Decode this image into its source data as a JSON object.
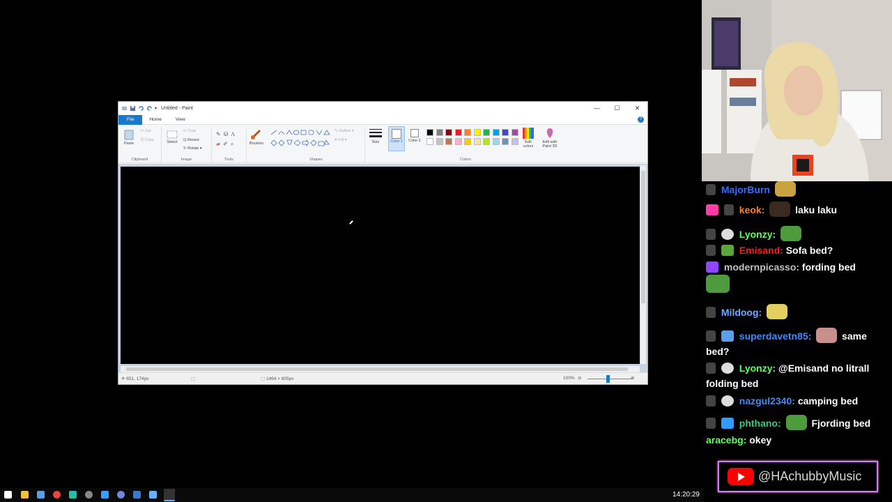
{
  "paint": {
    "title": "Untitled - Paint",
    "tabs": [
      "File",
      "Home",
      "View"
    ],
    "ribbon": {
      "paste": "Paste",
      "cut": "Cut",
      "copy": "Copy",
      "select": "Select",
      "crop": "Crop",
      "resize": "Resize",
      "rotate": "Rotate",
      "brushes": "Brushes",
      "outline": "Outline",
      "fill": "Fill",
      "size": "Size",
      "color1": "Color 1",
      "color2": "Color 2",
      "edit_colors": "Edit colors",
      "edit_paint3d": "Edit with Paint 3D",
      "groups": {
        "clipboard": "Clipboard",
        "image": "Image",
        "tools": "Tools",
        "shapes": "Shapes",
        "colors": "Colors"
      }
    },
    "palette": [
      "#000000",
      "#7f7f7f",
      "#880015",
      "#ed1c24",
      "#ff7f27",
      "#fff200",
      "#22b14c",
      "#00a2e8",
      "#3f48cc",
      "#a349a4",
      "#ffffff",
      "#c3c3c3",
      "#b97a57",
      "#ffaec9",
      "#ffc90e",
      "#efe4b0",
      "#b5e61d",
      "#99d9ea",
      "#7092be",
      "#c8bfe7"
    ],
    "status": {
      "cursor_pos": "651, 174px",
      "canvas_size": "1494 × 805px",
      "zoom": "100%"
    }
  },
  "chat": [
    {
      "user": "MajorBurn",
      "color": "#3b6bff",
      "text": ""
    },
    {
      "user": "keok:",
      "color": "#ff7f2a",
      "text": "laku laku"
    },
    {
      "user": "Lyonzy:",
      "color": "#5fff5f",
      "text": ""
    },
    {
      "user": "Emisand:",
      "color": "#ff1a1a",
      "text": "Sofa bed?"
    },
    {
      "user": "modernpicasso:",
      "color": "#c0c0c0",
      "text": "fording bed"
    },
    {
      "user": "Mildoog:",
      "color": "#6fa8ff",
      "text": ""
    },
    {
      "user": "superdavetn85:",
      "color": "#3d8bff",
      "text": "same",
      "text2": "bed?"
    },
    {
      "user": "Lyonzy:",
      "color": "#5fff5f",
      "text": "@Emisand no litrall",
      "text2": "folding bed"
    },
    {
      "user": "nazgul2340:",
      "color": "#3d8bff",
      "text": "camping bed"
    },
    {
      "user": "phthano:",
      "color": "#33cc77",
      "text": "Fjording bed"
    },
    {
      "user": "aracebg:",
      "color": "#5fff5f",
      "text": "okey"
    }
  ],
  "overlay": {
    "handle": "@HAchubbyMusic"
  },
  "taskbar": {
    "clock": "14:20:29"
  }
}
